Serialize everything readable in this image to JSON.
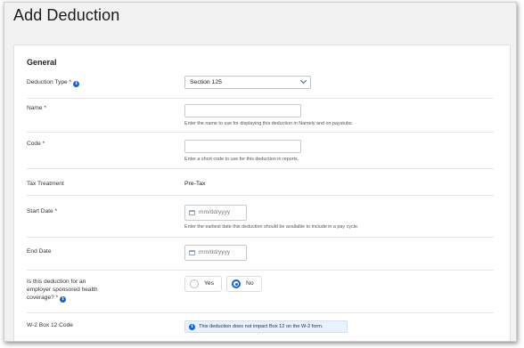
{
  "page": {
    "title": "Add Deduction"
  },
  "section": {
    "title": "General"
  },
  "deduction_type": {
    "label": "Deduction Type *",
    "value": "Section 125"
  },
  "name": {
    "label": "Name *",
    "value": "",
    "help": "Enter the name to use for displaying this deduction in Namely and on paystubs."
  },
  "code": {
    "label": "Code *",
    "value": "",
    "help": "Enter a short code to use for this deduction in reports."
  },
  "tax_treatment": {
    "label": "Tax Treatment",
    "value": "Pre-Tax"
  },
  "start_date": {
    "label": "Start Date *",
    "placeholder": "mm/dd/yyyy",
    "help": "Enter the earliest date this deduction should be available to include in a pay cycle."
  },
  "end_date": {
    "label": "End Date",
    "placeholder": "mm/dd/yyyy"
  },
  "health_coverage": {
    "label_line1": "Is this deduction for an",
    "label_line2": "employer sponsored health",
    "label_line3": "coverage? *",
    "options": [
      "Yes",
      "No"
    ],
    "selected": "No"
  },
  "w2_code": {
    "label": "W-2 Box 12 Code",
    "notice": "This deduction does not impact Box 12 on the W-2 form."
  },
  "icons": {
    "info": "info-icon",
    "calendar": "calendar-icon",
    "chevron": "chevron-down-icon"
  },
  "colors": {
    "accent": "#1c63c8",
    "notice_bg": "#e8f1fc"
  }
}
